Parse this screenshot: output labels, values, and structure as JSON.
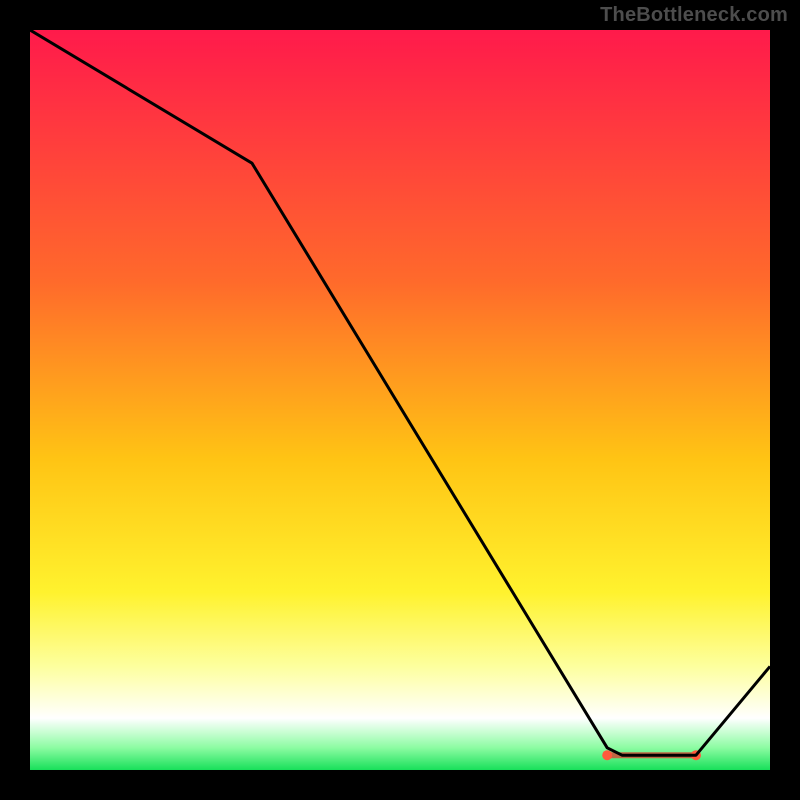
{
  "watermark": "TheBottleneck.com",
  "chart_data": {
    "type": "line",
    "title": "",
    "xlabel": "",
    "ylabel": "",
    "xlim": [
      0,
      100
    ],
    "ylim": [
      0,
      100
    ],
    "grid": false,
    "x": [
      0,
      30,
      78,
      80,
      84,
      86,
      88,
      90,
      100
    ],
    "values": [
      100,
      82,
      3,
      2,
      2,
      2,
      2,
      2,
      14
    ],
    "gradient_stops": [
      {
        "offset": 0,
        "color": "#ff1a4b"
      },
      {
        "offset": 34,
        "color": "#ff6a2b"
      },
      {
        "offset": 58,
        "color": "#ffc414"
      },
      {
        "offset": 76,
        "color": "#fff22e"
      },
      {
        "offset": 86,
        "color": "#fdff9e"
      },
      {
        "offset": 93,
        "color": "#ffffff"
      },
      {
        "offset": 97,
        "color": "#8cfca2"
      },
      {
        "offset": 100,
        "color": "#18e05a"
      }
    ],
    "highlight_band": {
      "x_start": 78,
      "x_end": 90,
      "y": 2,
      "dot_color": "#ff5a3c",
      "fill_color": "#c85a3c"
    }
  }
}
